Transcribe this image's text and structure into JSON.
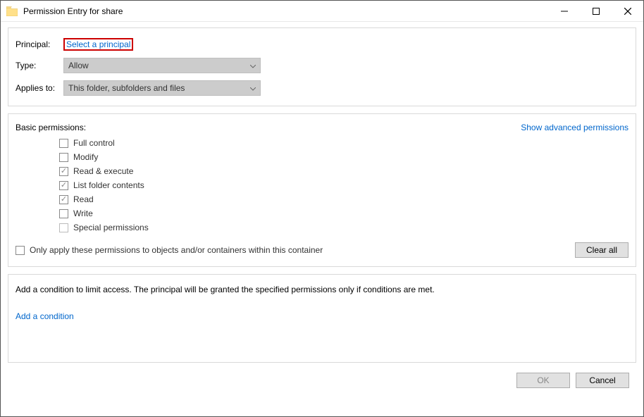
{
  "window": {
    "title": "Permission Entry for share"
  },
  "settings": {
    "principal_label": "Principal:",
    "principal_link": "Select a principal",
    "type_label": "Type:",
    "type_value": "Allow",
    "applies_label": "Applies to:",
    "applies_value": "This folder, subfolders and files"
  },
  "permissions": {
    "header": "Basic permissions:",
    "show_advanced": "Show advanced permissions",
    "items": [
      {
        "label": "Full control",
        "checked": false
      },
      {
        "label": "Modify",
        "checked": false
      },
      {
        "label": "Read & execute",
        "checked": true
      },
      {
        "label": "List folder contents",
        "checked": true
      },
      {
        "label": "Read",
        "checked": true
      },
      {
        "label": "Write",
        "checked": false
      },
      {
        "label": "Special permissions",
        "checked": false
      }
    ],
    "only_apply": "Only apply these permissions to objects and/or containers within this container",
    "clear_all": "Clear all"
  },
  "condition": {
    "description": "Add a condition to limit access. The principal will be granted the specified permissions only if conditions are met.",
    "add_link": "Add a condition"
  },
  "footer": {
    "ok": "OK",
    "cancel": "Cancel"
  }
}
